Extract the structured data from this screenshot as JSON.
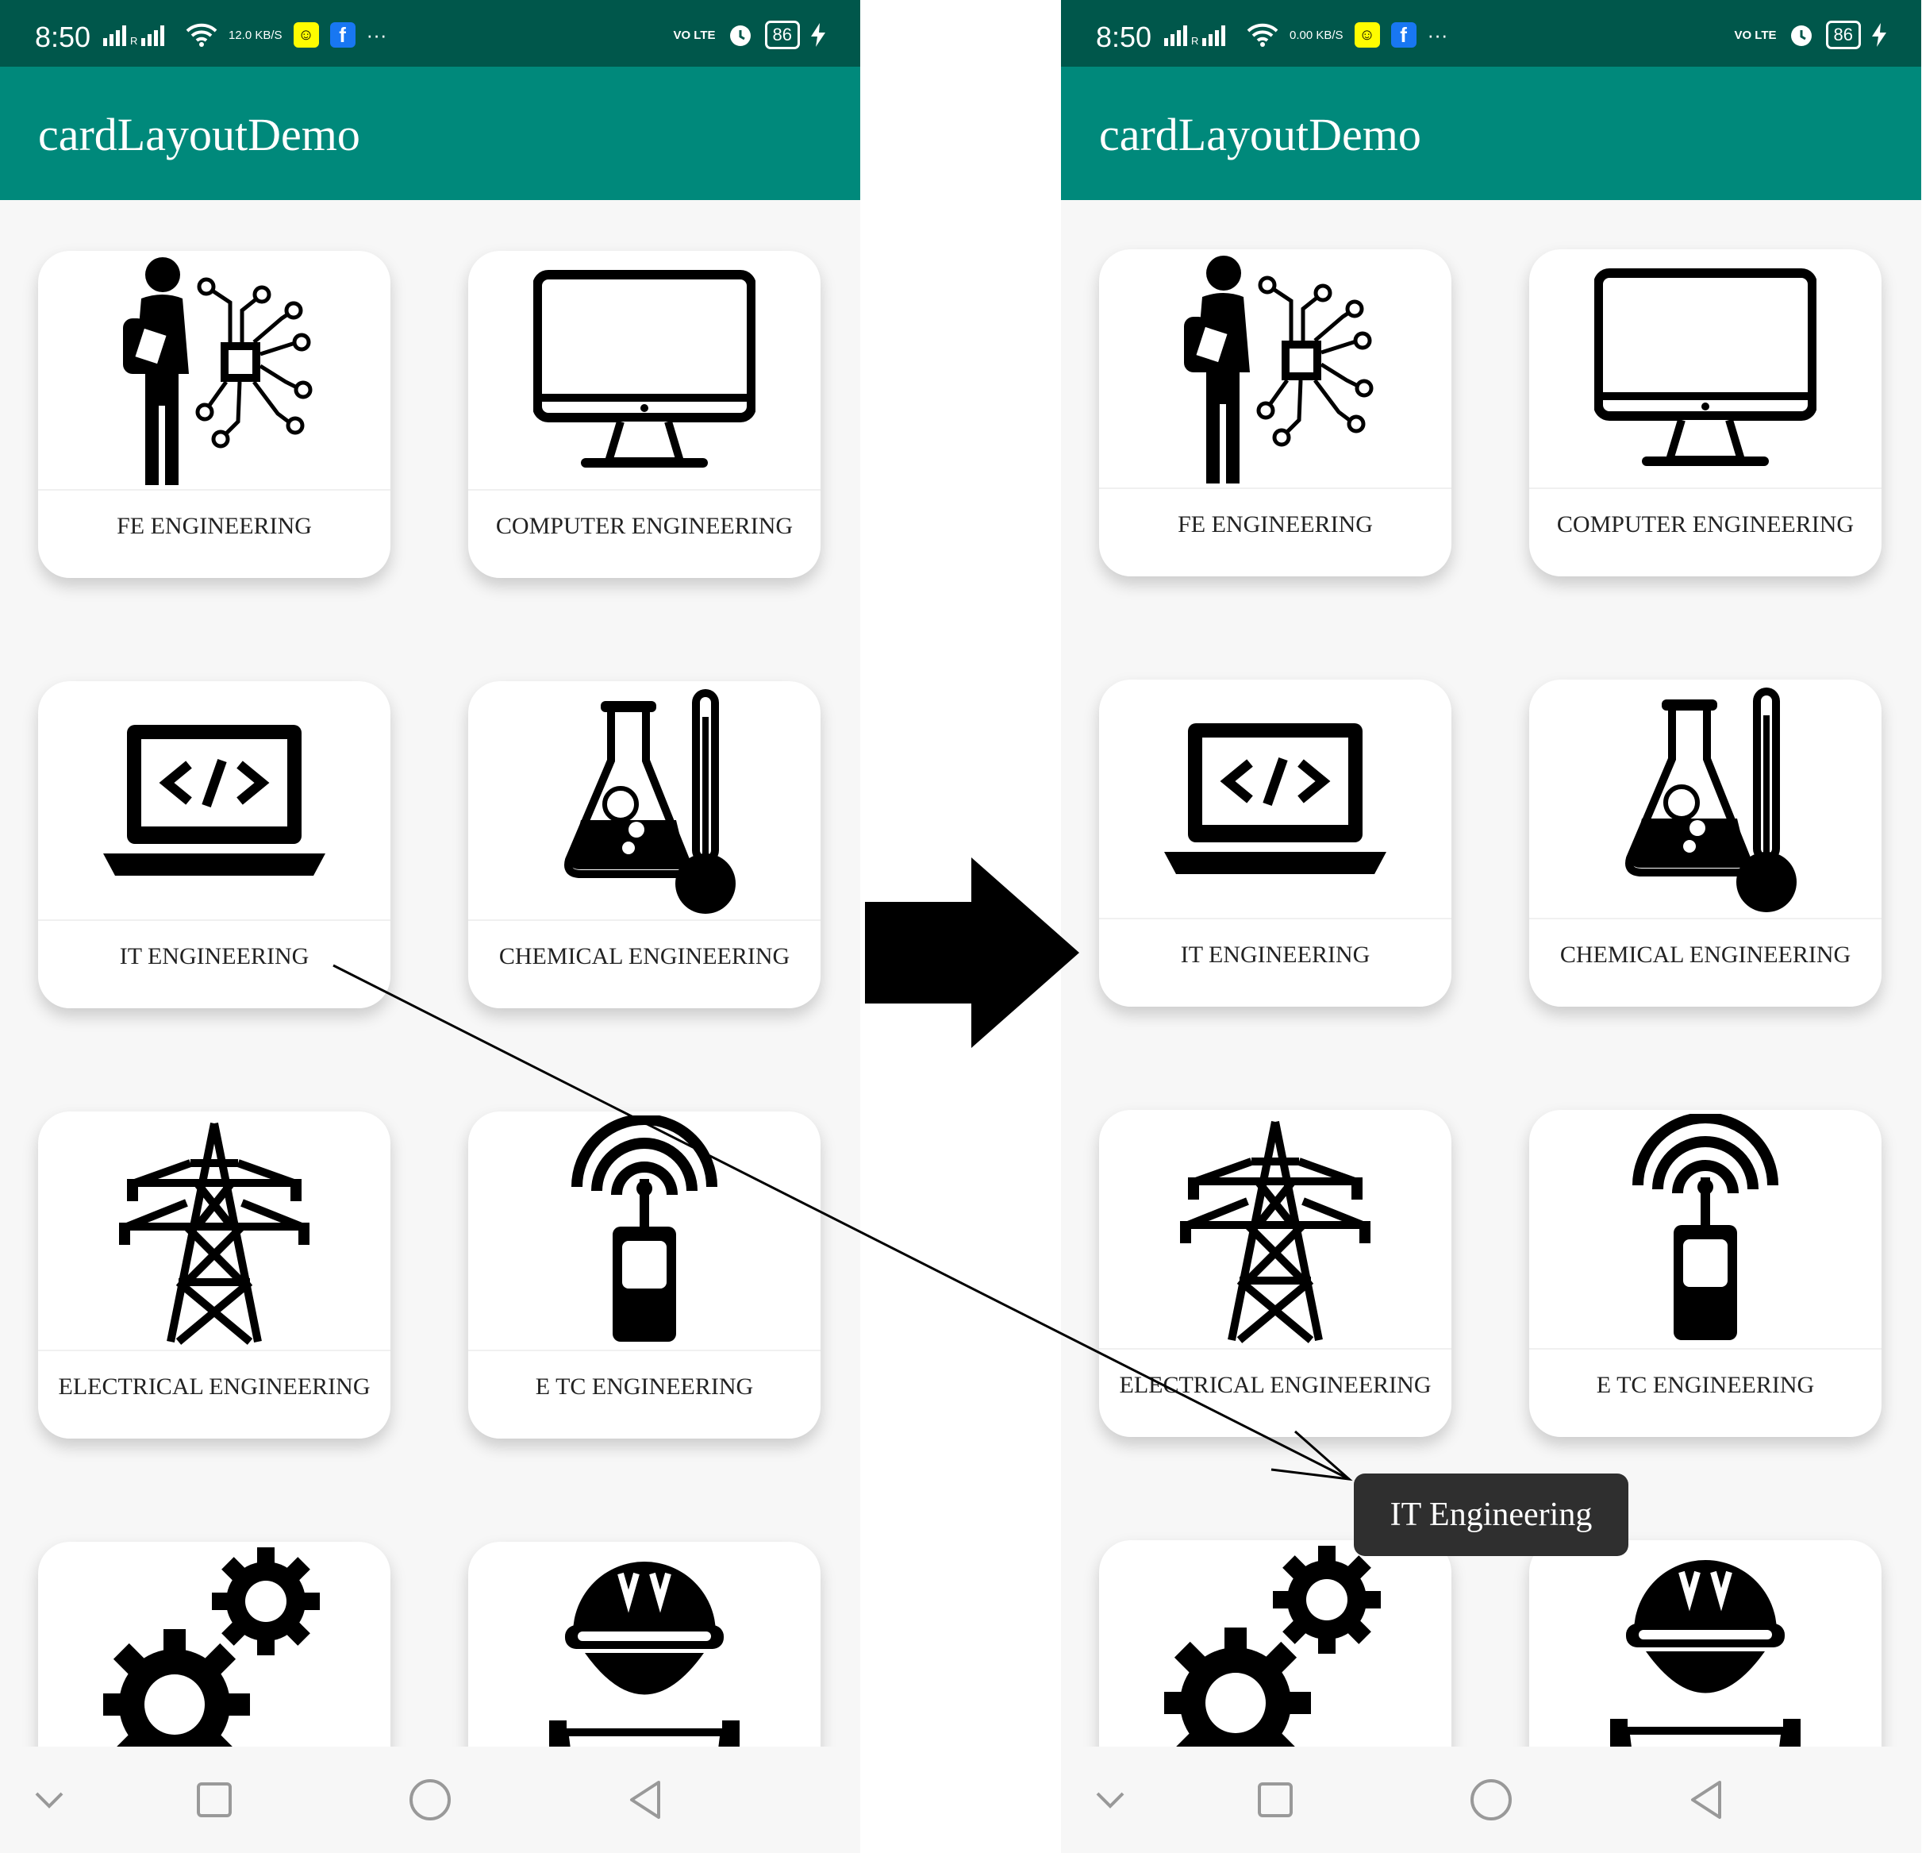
{
  "status_bar": {
    "time": "8:50",
    "speed_left": "12.0 KB/S",
    "speed_right": "0.00 KB/S",
    "volte": "VO LTE",
    "battery": "86",
    "overflow": "···",
    "signal_icon": "cell-signal-icon",
    "wifi_icon": "wifi-icon",
    "alarm_icon": "alarm-icon",
    "charging_icon": "charging-bolt-icon"
  },
  "app_bar": {
    "title": "cardLayoutDemo",
    "color": "#00897b",
    "status_color": "#00574b"
  },
  "cards": [
    {
      "label": "FE ENGINEERING",
      "icon": "student-circuit-icon"
    },
    {
      "label": "COMPUTER ENGINEERING",
      "icon": "desktop-monitor-icon"
    },
    {
      "label": "IT ENGINEERING",
      "icon": "laptop-code-icon"
    },
    {
      "label": "CHEMICAL ENGINEERING",
      "icon": "flask-thermometer-icon"
    },
    {
      "label": "ELECTRICAL ENGINEERING",
      "icon": "power-tower-icon"
    },
    {
      "label": "E TC ENGINEERING",
      "icon": "walkie-talkie-signal-icon"
    },
    {
      "label": "",
      "icon": "gears-icon"
    },
    {
      "label": "",
      "icon": "engineer-helmet-icon"
    }
  ],
  "nav_bar": {
    "buttons": [
      "chevron-down-icon",
      "recents-square-icon",
      "home-circle-icon",
      "back-triangle-icon"
    ]
  },
  "toast": {
    "text": "IT Engineering"
  },
  "annotation": {
    "big_arrow_icon": "right-arrow-icon",
    "pointer_line": "arrow-line"
  }
}
